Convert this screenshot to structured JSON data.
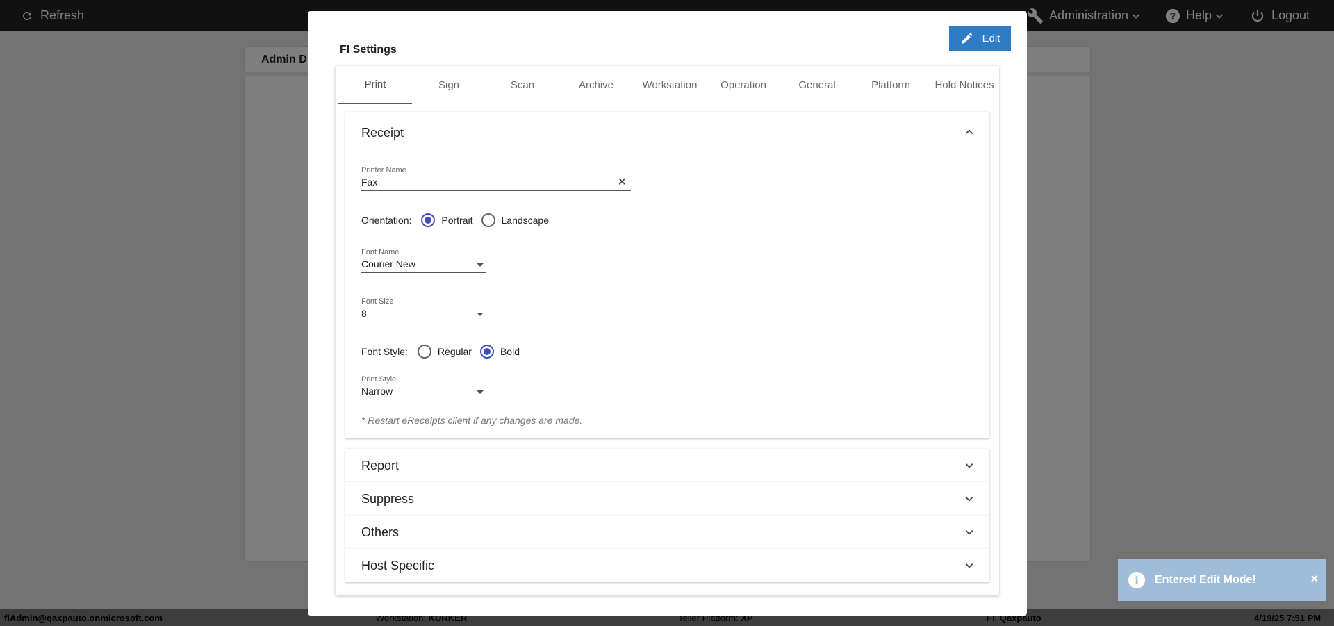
{
  "topbar": {
    "refresh_label": "Refresh",
    "administration_label": "Administration",
    "help_label": "Help",
    "logout_label": "Logout"
  },
  "background": {
    "card_title": "Admin D"
  },
  "modal": {
    "title": "FI Settings",
    "edit_label": "Edit",
    "tabs": [
      "Print",
      "Sign",
      "Scan",
      "Archive",
      "Workstation",
      "Operation",
      "General",
      "Platform",
      "Hold Notices"
    ],
    "active_tab": "Print",
    "receipt": {
      "title": "Receipt",
      "printer_name_label": "Printer Name",
      "printer_name_value": "Fax",
      "orientation_label": "Orientation:",
      "orientation_options": [
        "Portrait",
        "Landscape"
      ],
      "orientation_selected": "Portrait",
      "font_name_label": "Font Name",
      "font_name_value": "Courier New",
      "font_size_label": "Font Size",
      "font_size_value": "8",
      "font_style_label": "Font Style:",
      "font_style_options": [
        "Regular",
        "Bold"
      ],
      "font_style_selected": "Bold",
      "print_style_label": "Print Style",
      "print_style_value": "Narrow",
      "note": "* Restart eReceipts client if any changes are made."
    },
    "sections": [
      "Report",
      "Suppress",
      "Others",
      "Host Specific"
    ]
  },
  "footer": {
    "user": "fiAdmin@qaxpauto.onmicrosoft.com",
    "workstation_label": "Workstation:",
    "workstation_value": "KURKER",
    "teller_label": "Teller Platform:",
    "teller_value": "XP",
    "fi_label": "FI:",
    "fi_value": "Qaxpauto",
    "datetime": "4/19/25 7:51 PM"
  },
  "toast": {
    "message": "Entered Edit Mode!",
    "close": "×"
  },
  "colors": {
    "accent": "#3f51b5",
    "edit_button": "#2e7bc6",
    "topbar": "#222222",
    "toast": "#9fbcd8"
  }
}
